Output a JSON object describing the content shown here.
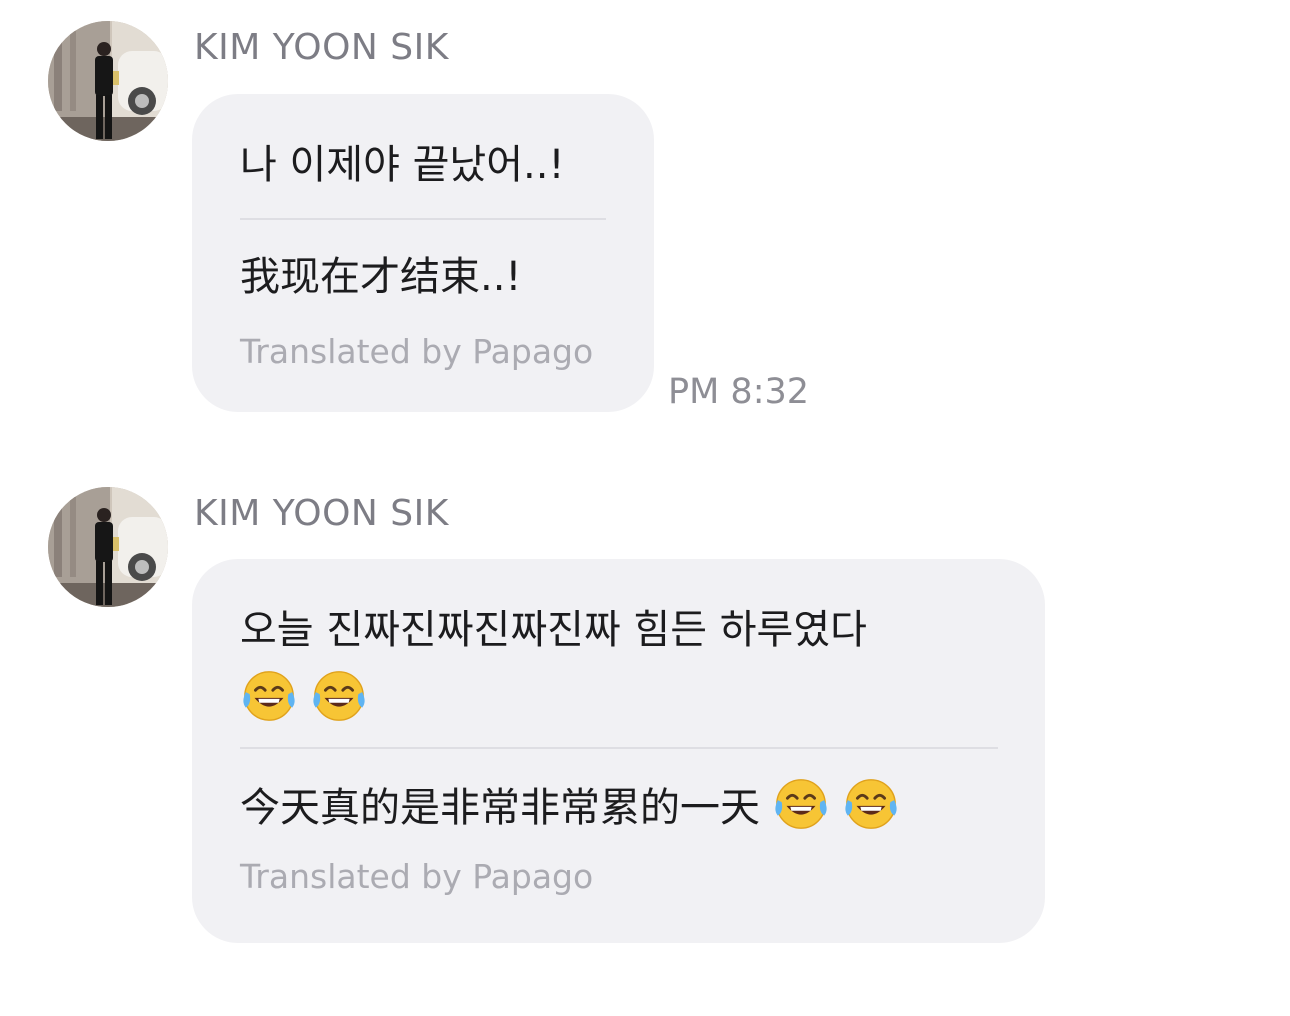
{
  "messages": [
    {
      "sender": "KIM YOON SIK",
      "original": "나 이제야 끝났어..!",
      "translation": "我现在才结束..!",
      "translated_by": "Translated by Papago",
      "time": "PM 8:32"
    },
    {
      "sender": "KIM YOON SIK",
      "original": "오늘 진짜진짜진짜진짜 힘든 하루였다",
      "original_emoji": [
        "face-with-tears-of-joy-icon",
        "face-with-tears-of-joy-icon"
      ],
      "translation": "今天真的是非常非常累的一天",
      "translation_emoji": [
        "face-with-tears-of-joy-icon",
        "face-with-tears-of-joy-icon"
      ],
      "translated_by": "Translated by Papago"
    }
  ],
  "colors": {
    "bubble_background": "#f1f1f4",
    "sender_name": "#7d7d85",
    "secondary_text": "#ababb2",
    "timestamp": "#8e8e95"
  }
}
